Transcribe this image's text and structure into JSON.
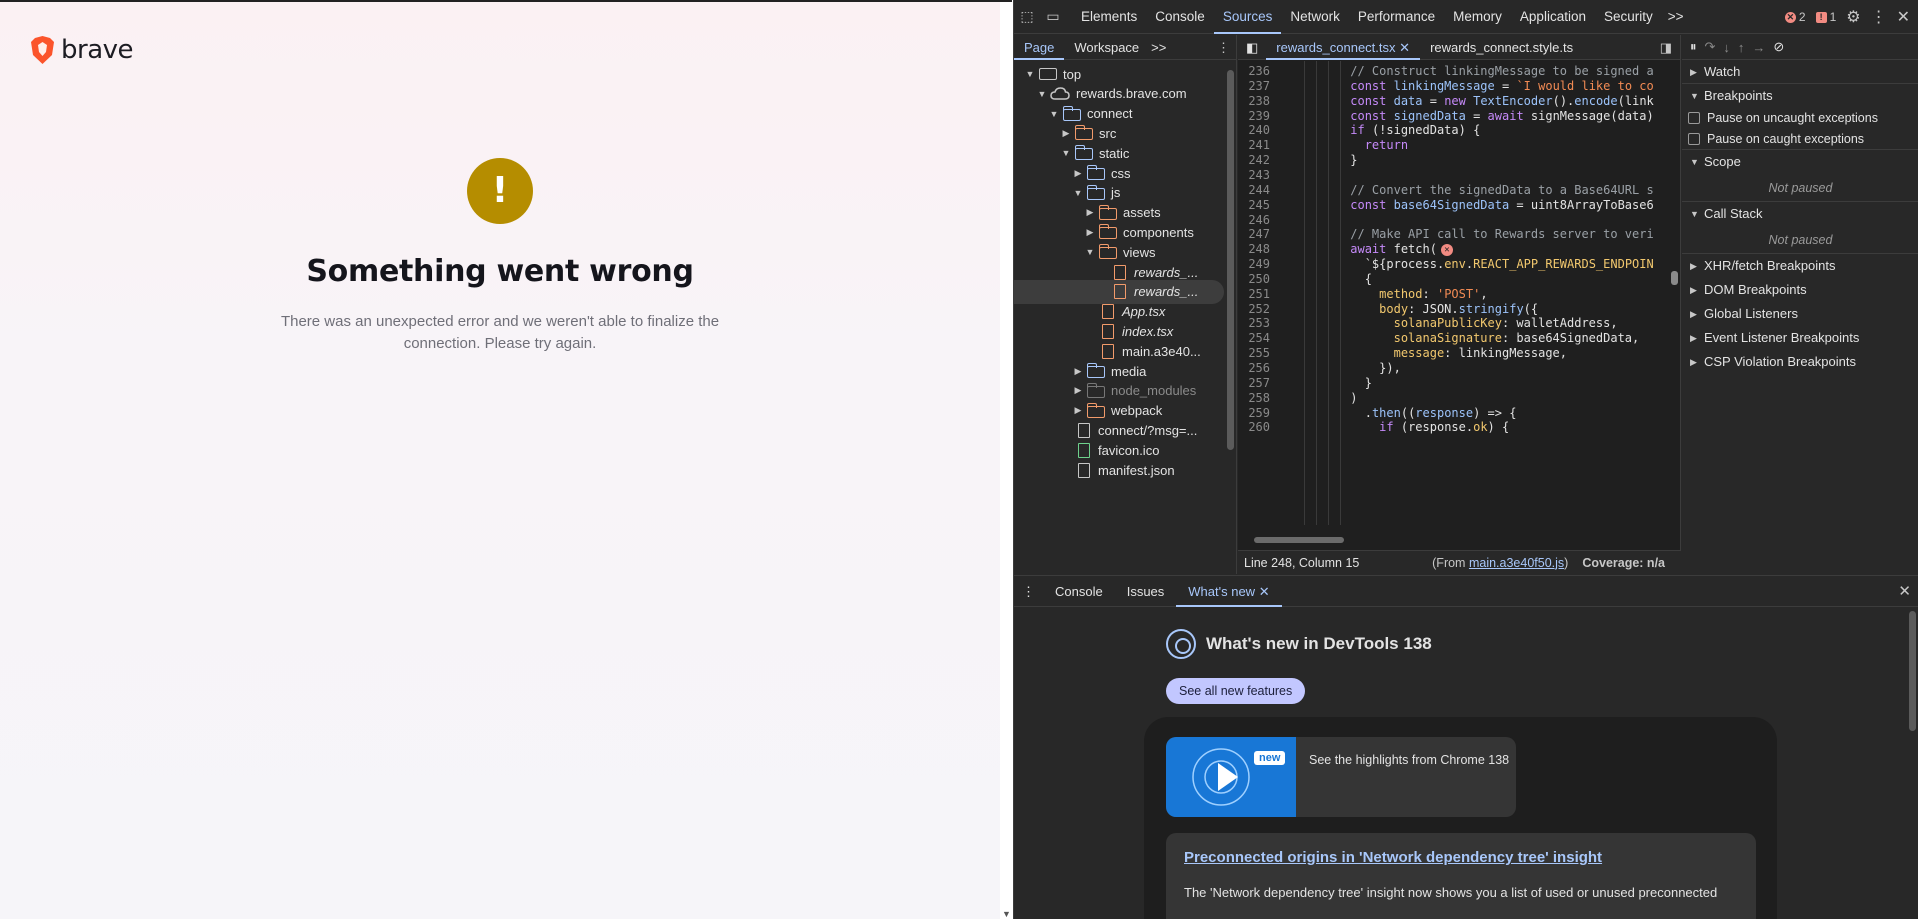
{
  "page": {
    "brand": "brave",
    "error_title": "Something went wrong",
    "error_message": "There was an unexpected error and we weren't able to finalize the connection. Please try again.",
    "error_icon_glyph": "!",
    "accent": "#b58d00"
  },
  "devtools": {
    "tabs": [
      "Elements",
      "Console",
      "Sources",
      "Network",
      "Performance",
      "Memory",
      "Application",
      "Security"
    ],
    "active_tab": "Sources",
    "more_tabs": ">>",
    "error_count": "2",
    "warning_count": "1",
    "navigator": {
      "tabs": [
        "Page",
        "Workspace"
      ],
      "more": ">>",
      "tree": [
        {
          "label": "top",
          "icon": "frame",
          "depth": 0,
          "open": true
        },
        {
          "label": "rewards.brave.com",
          "icon": "cloud",
          "depth": 1,
          "open": true
        },
        {
          "label": "connect",
          "icon": "folder",
          "depth": 2,
          "open": true
        },
        {
          "label": "src",
          "icon": "folder-orange",
          "depth": 3,
          "open": false
        },
        {
          "label": "static",
          "icon": "folder",
          "depth": 3,
          "open": true
        },
        {
          "label": "css",
          "icon": "folder",
          "depth": 4,
          "open": false
        },
        {
          "label": "js",
          "icon": "folder",
          "depth": 4,
          "open": true
        },
        {
          "label": "assets",
          "icon": "folder-orange",
          "depth": 5,
          "open": false
        },
        {
          "label": "components",
          "icon": "folder-orange",
          "depth": 5,
          "open": false
        },
        {
          "label": "views",
          "icon": "folder-orange",
          "depth": 5,
          "open": true
        },
        {
          "label": "rewards_...",
          "icon": "file-orange",
          "depth": 6,
          "italic": true
        },
        {
          "label": "rewards_...",
          "icon": "file-orange",
          "depth": 6,
          "italic": true,
          "selected": true
        },
        {
          "label": "App.tsx",
          "icon": "file-orange",
          "depth": 5,
          "italic": true
        },
        {
          "label": "index.tsx",
          "icon": "file-orange",
          "depth": 5,
          "italic": true
        },
        {
          "label": "main.a3e40...",
          "icon": "file-orange",
          "depth": 5
        },
        {
          "label": "media",
          "icon": "folder",
          "depth": 4,
          "open": false
        },
        {
          "label": "node_modules",
          "icon": "folder-dim",
          "depth": 4,
          "open": false,
          "dim": true
        },
        {
          "label": "webpack",
          "icon": "folder-orange",
          "depth": 4,
          "open": false
        },
        {
          "label": "connect/?msg=...",
          "icon": "file-white",
          "depth": 3
        },
        {
          "label": "favicon.ico",
          "icon": "file-green",
          "depth": 3
        },
        {
          "label": "manifest.json",
          "icon": "file-white",
          "depth": 3
        }
      ]
    },
    "editor": {
      "tabs": [
        {
          "label": "rewards_connect.tsx",
          "closable": true,
          "active": true
        },
        {
          "label": "rewards_connect.style.ts",
          "closable": false,
          "active": false
        }
      ],
      "lines": [
        {
          "n": "236",
          "indent": 6,
          "parts": [
            [
              "c",
              "// Construct linkingMessage to be signed a"
            ]
          ]
        },
        {
          "n": "237",
          "indent": 6,
          "parts": [
            [
              "k",
              "const "
            ],
            [
              "v",
              "linkingMessage"
            ],
            [
              "p",
              " = "
            ],
            [
              "s",
              "`I would like to co"
            ]
          ]
        },
        {
          "n": "238",
          "indent": 6,
          "parts": [
            [
              "k",
              "const "
            ],
            [
              "v",
              "data"
            ],
            [
              "p",
              " = "
            ],
            [
              "k",
              "new "
            ],
            [
              "fn",
              "TextEncoder"
            ],
            [
              "p",
              "()."
            ],
            [
              "fn",
              "encode"
            ],
            [
              "p",
              "(link"
            ]
          ]
        },
        {
          "n": "239",
          "indent": 6,
          "parts": [
            [
              "k",
              "const "
            ],
            [
              "v",
              "signedData"
            ],
            [
              "p",
              " = "
            ],
            [
              "k",
              "await "
            ],
            [
              "p",
              "signMessage(data)"
            ]
          ]
        },
        {
          "n": "240",
          "indent": 6,
          "parts": [
            [
              "k",
              "if "
            ],
            [
              "p",
              "(!signedData) {"
            ]
          ]
        },
        {
          "n": "241",
          "indent": 7,
          "parts": [
            [
              "k",
              "return"
            ]
          ]
        },
        {
          "n": "242",
          "indent": 6,
          "parts": [
            [
              "p",
              "}"
            ]
          ]
        },
        {
          "n": "243",
          "indent": 6,
          "parts": []
        },
        {
          "n": "244",
          "indent": 6,
          "parts": [
            [
              "c",
              "// Convert the signedData to a Base64URL s"
            ]
          ]
        },
        {
          "n": "245",
          "indent": 6,
          "parts": [
            [
              "k",
              "const "
            ],
            [
              "v",
              "base64SignedData"
            ],
            [
              "p",
              " = uint8ArrayToBase6"
            ]
          ]
        },
        {
          "n": "246",
          "indent": 6,
          "parts": []
        },
        {
          "n": "247",
          "indent": 6,
          "parts": [
            [
              "c",
              "// Make API call to Rewards server to veri"
            ]
          ]
        },
        {
          "n": "248",
          "indent": 6,
          "parts": [
            [
              "k",
              "await "
            ],
            [
              "p",
              "fetch("
            ]
          ],
          "error": true
        },
        {
          "n": "249",
          "indent": 7,
          "parts": [
            [
              "p",
              "`${process."
            ],
            [
              "y",
              "env"
            ],
            [
              "p",
              "."
            ],
            [
              "y",
              "REACT_APP_REWARDS_ENDPOIN"
            ]
          ]
        },
        {
          "n": "250",
          "indent": 7,
          "parts": [
            [
              "p",
              "{"
            ]
          ]
        },
        {
          "n": "251",
          "indent": 8,
          "parts": [
            [
              "y",
              "method"
            ],
            [
              "p",
              ": "
            ],
            [
              "s",
              "'POST'"
            ],
            [
              "p",
              ","
            ]
          ]
        },
        {
          "n": "252",
          "indent": 8,
          "parts": [
            [
              "y",
              "body"
            ],
            [
              "p",
              ": JSON."
            ],
            [
              "fn",
              "stringify"
            ],
            [
              "p",
              "({"
            ]
          ]
        },
        {
          "n": "253",
          "indent": 9,
          "parts": [
            [
              "y",
              "solanaPublicKey"
            ],
            [
              "p",
              ": walletAddress,"
            ]
          ]
        },
        {
          "n": "254",
          "indent": 9,
          "parts": [
            [
              "y",
              "solanaSignature"
            ],
            [
              "p",
              ": base64SignedData,"
            ]
          ]
        },
        {
          "n": "255",
          "indent": 9,
          "parts": [
            [
              "y",
              "message"
            ],
            [
              "p",
              ": linkingMessage,"
            ]
          ]
        },
        {
          "n": "256",
          "indent": 8,
          "parts": [
            [
              "p",
              "}),"
            ]
          ]
        },
        {
          "n": "257",
          "indent": 7,
          "parts": [
            [
              "p",
              "}"
            ]
          ]
        },
        {
          "n": "258",
          "indent": 6,
          "parts": [
            [
              "p",
              ")"
            ]
          ]
        },
        {
          "n": "259",
          "indent": 7,
          "parts": [
            [
              "p",
              "."
            ],
            [
              "fn",
              "then"
            ],
            [
              "p",
              "(("
            ],
            [
              "v",
              "response"
            ],
            [
              "p",
              ") => {"
            ]
          ]
        },
        {
          "n": "260",
          "indent": 8,
          "parts": [
            [
              "k",
              "if "
            ],
            [
              "p",
              "(response."
            ],
            [
              "y",
              "ok"
            ],
            [
              "p",
              ") {"
            ]
          ]
        }
      ],
      "status_position": "Line 248, Column 15",
      "status_from_prefix": "(From ",
      "status_from_file": "main.a3e40f50.js",
      "status_from_suffix": ")",
      "status_coverage": "Coverage: n/a"
    },
    "debugger": {
      "watch": "Watch",
      "breakpoints": "Breakpoints",
      "pause_uncaught": "Pause on uncaught exceptions",
      "pause_caught": "Pause on caught exceptions",
      "scope": "Scope",
      "scope_status": "Not paused",
      "call_stack": "Call Stack",
      "call_stack_status": "Not paused",
      "more_sections": [
        "XHR/fetch Breakpoints",
        "DOM Breakpoints",
        "Global Listeners",
        "Event Listener Breakpoints",
        "CSP Violation Breakpoints"
      ]
    },
    "drawer": {
      "tabs": [
        "Console",
        "Issues",
        "What's new"
      ],
      "active_tab": "What's new",
      "whats_new_title": "What's new in DevTools 138",
      "see_all_button": "See all new features",
      "highlight_badge": "new",
      "highlight_text": "See the highlights from Chrome 138",
      "article_title": "Preconnected origins in 'Network dependency tree' insight",
      "article_desc": "The 'Network dependency tree' insight now shows you a list of used or unused preconnected"
    }
  }
}
